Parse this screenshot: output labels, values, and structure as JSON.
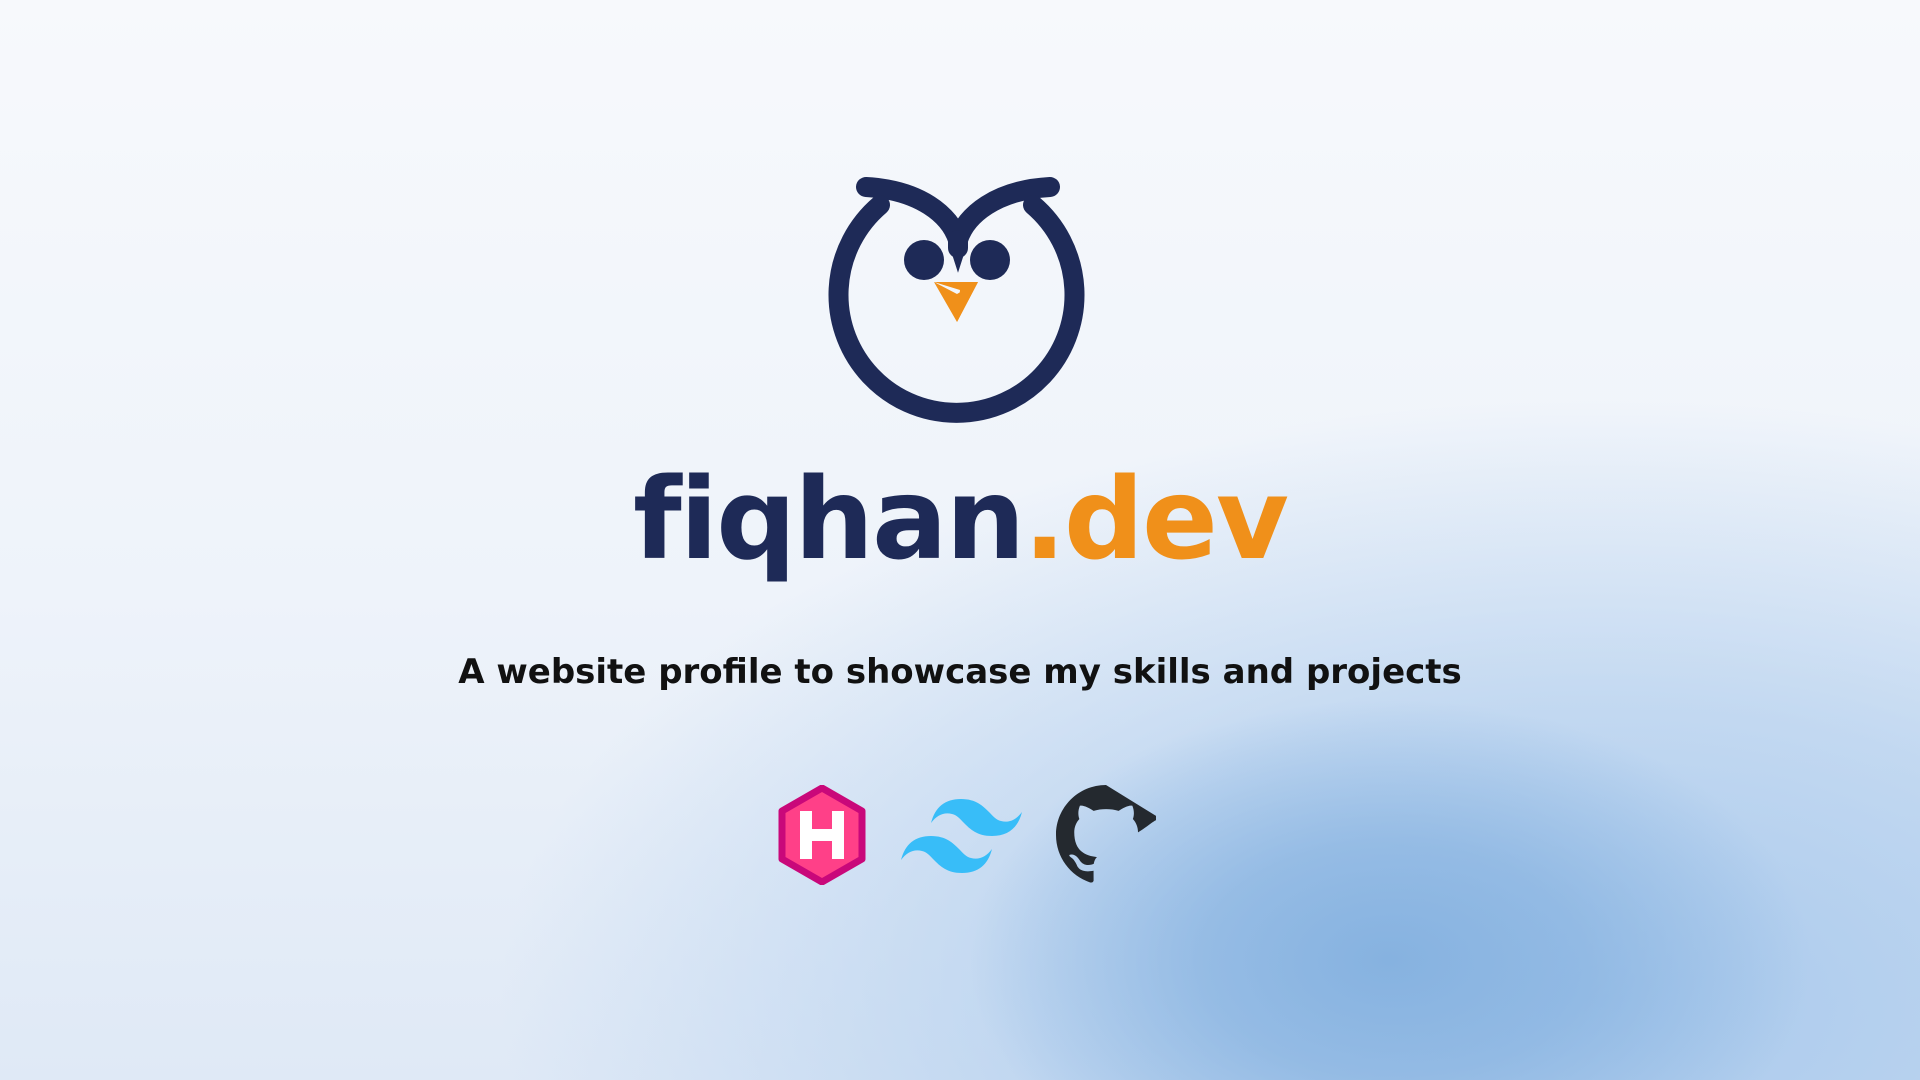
{
  "brand": {
    "name": "fiqhan",
    "tld": ".dev"
  },
  "tagline": "A website profile to showcase my skills and projects",
  "tech_icons": [
    "hugo-icon",
    "tailwind-icon",
    "github-icon"
  ],
  "colors": {
    "navy": "#1e2a57",
    "orange": "#f0901a",
    "hugo": "#ff4088",
    "tailwind": "#38bdf8",
    "github": "#24292f"
  }
}
